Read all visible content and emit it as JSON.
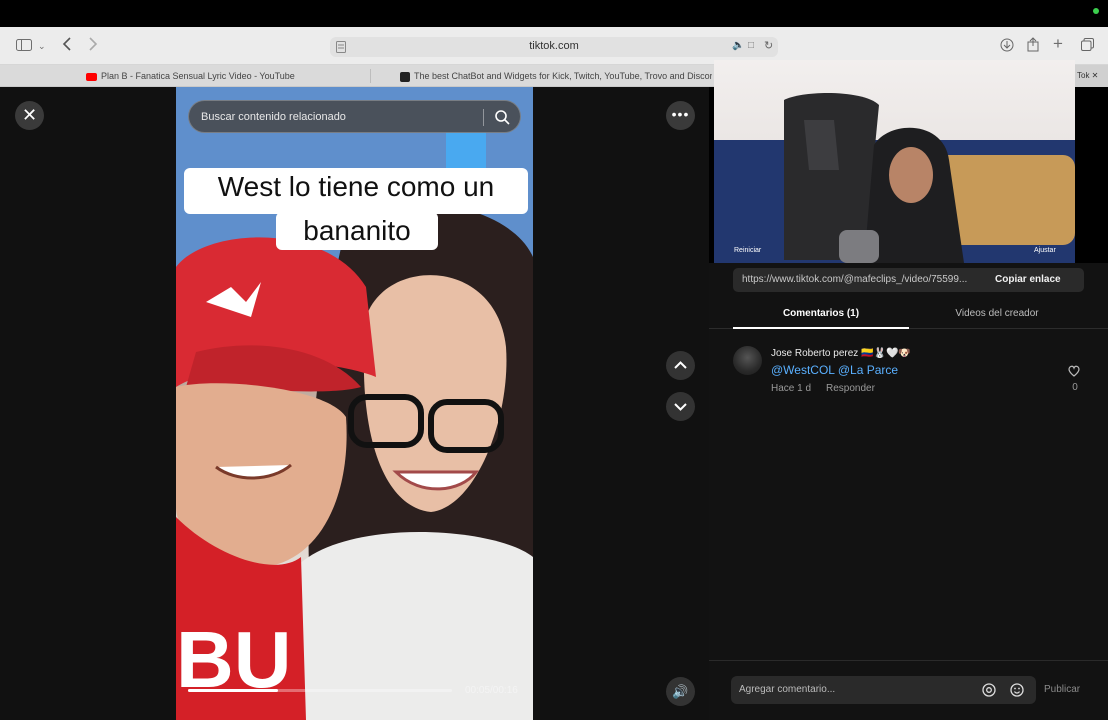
{
  "browser": {
    "url": "tiktok.com",
    "tabs": [
      {
        "label": "Plan B - Fanatica Sensual Lyric Video - YouTube",
        "icon": "youtube-icon"
      },
      {
        "label": "The best ChatBot and Widgets for Kick, Twitch, YouTube, Trovo and Discord",
        "icon": "botrix-icon"
      },
      {
        "label": "Tok ✕",
        "icon": "tiktok-icon"
      }
    ]
  },
  "player": {
    "search_placeholder": "Buscar contenido relacionado",
    "caption_line1": "West lo tiene como un",
    "caption_line2": "bananito",
    "time": "00:05/00:16",
    "progress": 0.34
  },
  "panel": {
    "link_url": "https://www.tiktok.com/@mafeclips_/video/75599...",
    "copy_label": "Copiar enlace",
    "tab_comments": "Comentarios (1)",
    "tab_videos": "Videos del creador",
    "comment": {
      "user": "Jose Roberto perez 🇨🇴🐰🤍🐶",
      "text": "@WestCOL @La Parce",
      "time": "Hace 1 d",
      "reply": "Responder",
      "likes": "0"
    },
    "input_placeholder": "Agregar comentario...",
    "publish_label": "Publicar"
  },
  "webcam": {
    "left_label": "Reiniciar",
    "right_label": "Ajustar"
  },
  "colors": {
    "background": "#000000",
    "panel": "#121212",
    "mention": "#5ab0ff"
  }
}
